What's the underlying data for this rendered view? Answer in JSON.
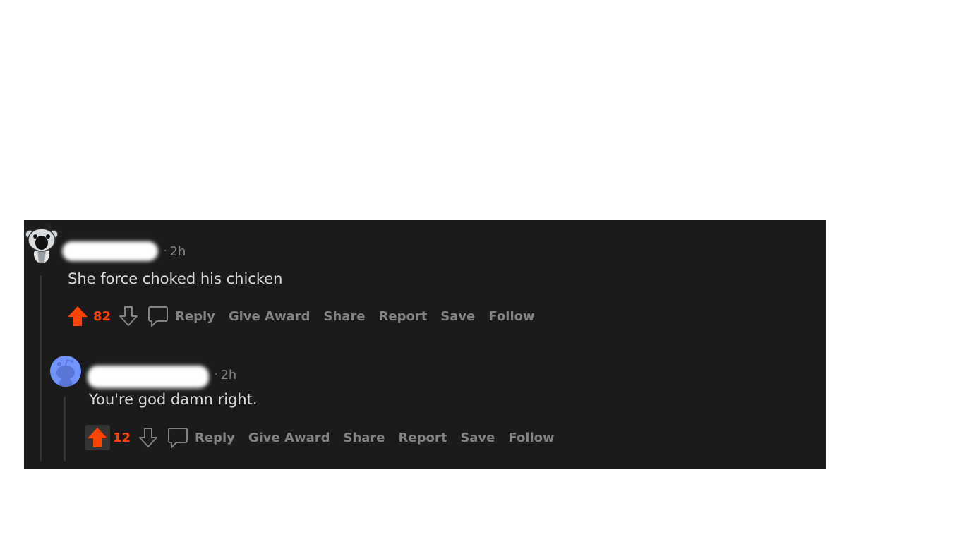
{
  "comments": [
    {
      "timestamp": "2h",
      "body": "She force choked his chicken",
      "score": "82",
      "actions": {
        "reply": "Reply",
        "give_award": "Give Award",
        "share": "Share",
        "report": "Report",
        "save": "Save",
        "follow": "Follow"
      }
    },
    {
      "timestamp": "2h",
      "body": "You're god damn right.",
      "score": "12",
      "actions": {
        "reply": "Reply",
        "give_award": "Give Award",
        "share": "Share",
        "report": "Report",
        "save": "Save",
        "follow": "Follow"
      }
    }
  ],
  "colors": {
    "background": "#1b1b1b",
    "upvote": "#ff4500",
    "text": "#d7dadc",
    "muted": "#818384",
    "avatar_blue": "#7193ff"
  },
  "icons": {
    "upvote": "upvote-arrow-icon",
    "downvote": "downvote-arrow-icon",
    "reply": "speech-bubble-icon",
    "avatar1": "snoo-avatar-icon",
    "avatar2": "default-snoo-avatar-icon"
  }
}
